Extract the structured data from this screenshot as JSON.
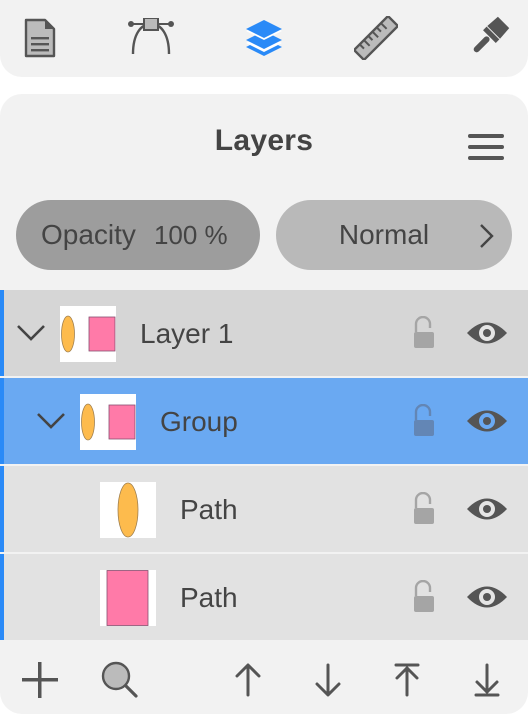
{
  "toolbar": {
    "tools": [
      {
        "name": "document",
        "icon": "document-icon",
        "active": false
      },
      {
        "name": "path-edit",
        "icon": "bezier-icon",
        "active": false
      },
      {
        "name": "layers",
        "icon": "layers-icon",
        "active": true
      },
      {
        "name": "measure",
        "icon": "ruler-icon",
        "active": false
      },
      {
        "name": "style",
        "icon": "brush-icon",
        "active": false
      }
    ],
    "accent_color": "#2a8af7"
  },
  "panel": {
    "title": "Layers",
    "menu_icon": "hamburger-menu-icon",
    "opacity": {
      "label": "Opacity",
      "value": "100 %"
    },
    "blend_mode": {
      "value": "Normal",
      "icon": "chevron-right-icon"
    }
  },
  "layers": [
    {
      "name": "Layer 1",
      "level": 0,
      "expanded": true,
      "selected": false,
      "locked": false,
      "visible": true,
      "thumbnail": "ellipse-and-rectangle"
    },
    {
      "name": "Group",
      "level": 1,
      "expanded": true,
      "selected": true,
      "locked": false,
      "visible": true,
      "thumbnail": "ellipse-and-rectangle"
    },
    {
      "name": "Path",
      "level": 2,
      "selected": false,
      "locked": false,
      "visible": true,
      "thumbnail": "ellipse"
    },
    {
      "name": "Path",
      "level": 2,
      "selected": false,
      "locked": false,
      "visible": true,
      "thumbnail": "rectangle"
    }
  ],
  "shape_colors": {
    "ellipse": "#fdbb4d",
    "rectangle": "#ff7aa8"
  },
  "bottombar": {
    "buttons": [
      {
        "name": "add-layer",
        "icon": "plus-icon"
      },
      {
        "name": "search-layers",
        "icon": "search-icon"
      },
      {
        "name": "move-up",
        "icon": "arrow-up-icon"
      },
      {
        "name": "move-down",
        "icon": "arrow-down-icon"
      },
      {
        "name": "move-to-top",
        "icon": "arrow-to-top-icon"
      },
      {
        "name": "move-to-bottom",
        "icon": "arrow-to-bottom-icon"
      }
    ]
  }
}
